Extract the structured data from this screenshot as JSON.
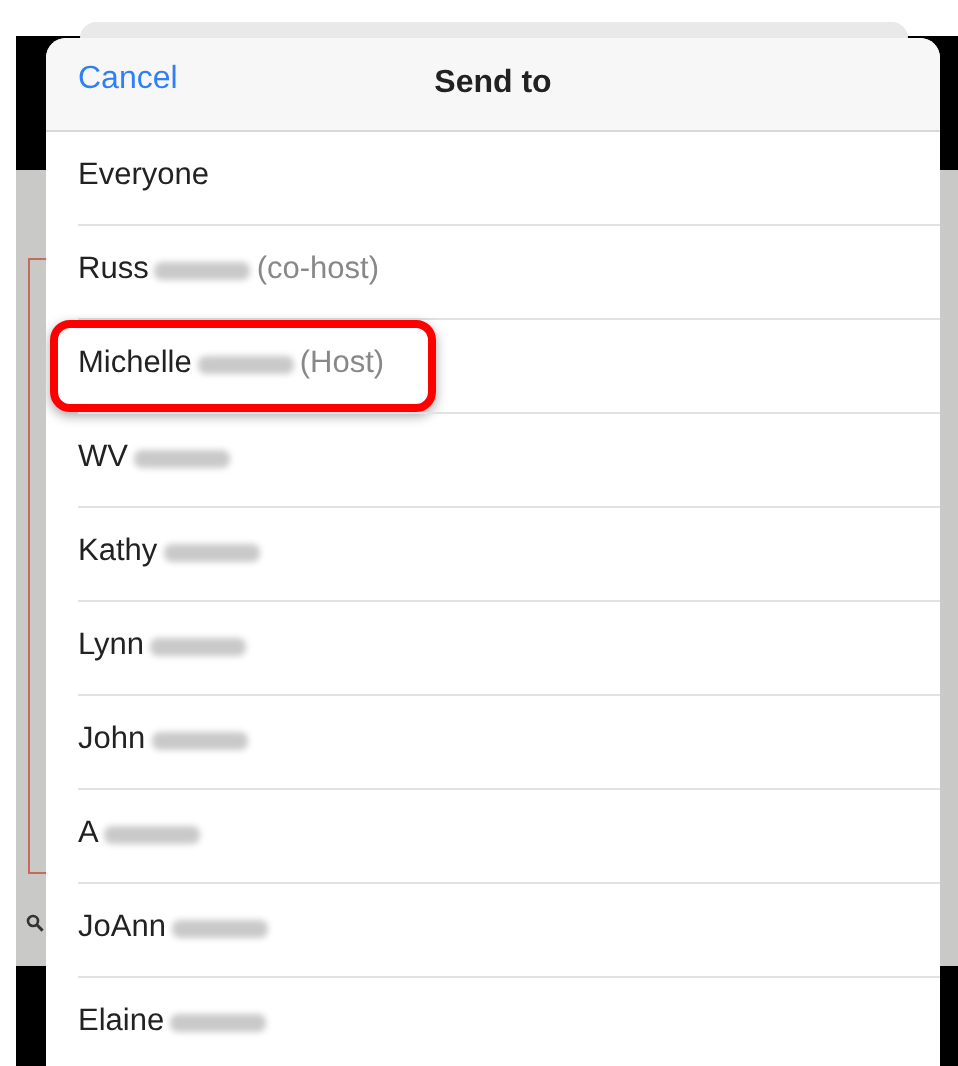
{
  "header": {
    "cancel": "Cancel",
    "title": "Send to"
  },
  "recipients": [
    {
      "name": "Everyone",
      "redacted": false,
      "highlighted": false
    },
    {
      "name": "Russ",
      "redacted": true,
      "role": "(co-host)",
      "highlighted": false
    },
    {
      "name": "Michelle",
      "redacted": true,
      "role": "(Host)",
      "highlighted": true
    },
    {
      "name": "WV",
      "redacted": true,
      "highlighted": false
    },
    {
      "name": "Kathy",
      "redacted": true,
      "highlighted": false
    },
    {
      "name": "Lynn",
      "redacted": true,
      "highlighted": false
    },
    {
      "name": "John",
      "redacted": true,
      "highlighted": false
    },
    {
      "name": "A",
      "redacted": true,
      "highlighted": false
    },
    {
      "name": "JoAnn",
      "redacted": true,
      "highlighted": false
    },
    {
      "name": "Elaine",
      "redacted": true,
      "highlighted": false
    }
  ]
}
